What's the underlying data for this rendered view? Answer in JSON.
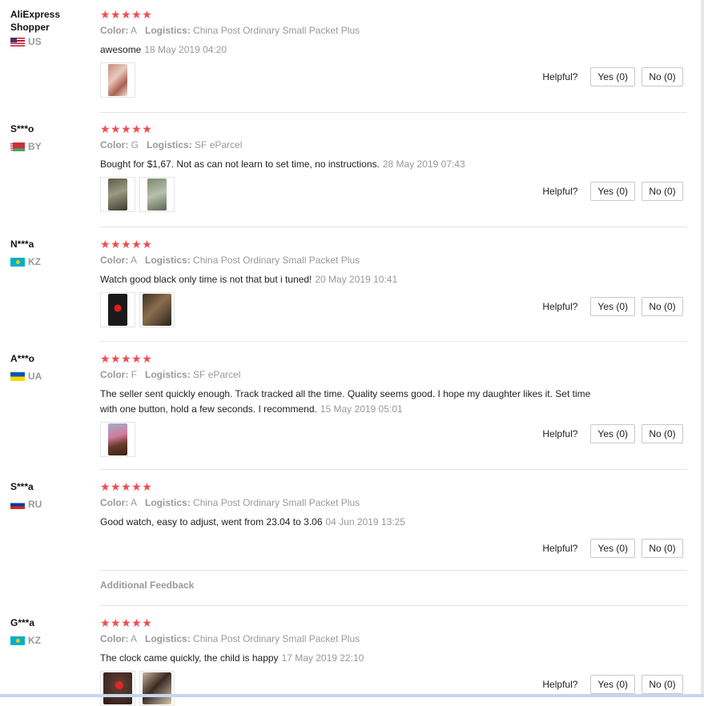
{
  "buttons": {
    "helpful_label": "Helpful?"
  },
  "labels": {
    "color": "Color:",
    "logistics": "Logistics:"
  },
  "additional_feedback": "Additional Feedback",
  "reviews": [
    {
      "user": "AliExpress Shopper",
      "country": "US",
      "flag": "us",
      "stars": "★★★★★",
      "color": "A",
      "logistics": "China Post Ordinary Small Packet Plus",
      "text": "awesome",
      "date": "18 May 2019 04:20",
      "yes": "Yes (0)",
      "no": "No (0)"
    },
    {
      "user": "S***o",
      "country": "BY",
      "flag": "by",
      "stars": "★★★★★",
      "color": "G",
      "logistics": "SF eParcel",
      "text": "Bought for $1,67. Not as can not learn to set time, no instructions.",
      "date": "28 May 2019 07:43",
      "yes": "Yes (0)",
      "no": "No (0)"
    },
    {
      "user": "N***a",
      "country": "KZ",
      "flag": "kz",
      "stars": "★★★★★",
      "color": "A",
      "logistics": "China Post Ordinary Small Packet Plus",
      "text": "Watch good black only time is not that but i tuned!",
      "date": "20 May 2019 10:41",
      "yes": "Yes (0)",
      "no": "No (0)"
    },
    {
      "user": "A***o",
      "country": "UA",
      "flag": "ua",
      "stars": "★★★★★",
      "color": "F",
      "logistics": "SF eParcel",
      "text": "The seller sent quickly enough. Track tracked all the time. Quality seems good. I hope my daughter likes it. Set time with one button, hold a few seconds. I recommend.",
      "date": "15 May 2019 05:01",
      "yes": "Yes (0)",
      "no": "No (0)"
    },
    {
      "user": "S***a",
      "country": "RU",
      "flag": "ru",
      "stars": "★★★★★",
      "color": "A",
      "logistics": "China Post Ordinary Small Packet Plus",
      "text": "Good watch, easy to adjust, went from 23.04 to 3.06",
      "date": "04 Jun 2019 13:25",
      "yes": "Yes (0)",
      "no": "No (0)"
    },
    {
      "user": "G***a",
      "country": "KZ",
      "flag": "kz",
      "stars": "★★★★★",
      "color": "A",
      "logistics": "China Post Ordinary Small Packet Plus",
      "text": "The clock came quickly, the child is happy",
      "date": "17 May 2019 22:10",
      "yes": "Yes (0)",
      "no": "No (0)"
    }
  ]
}
